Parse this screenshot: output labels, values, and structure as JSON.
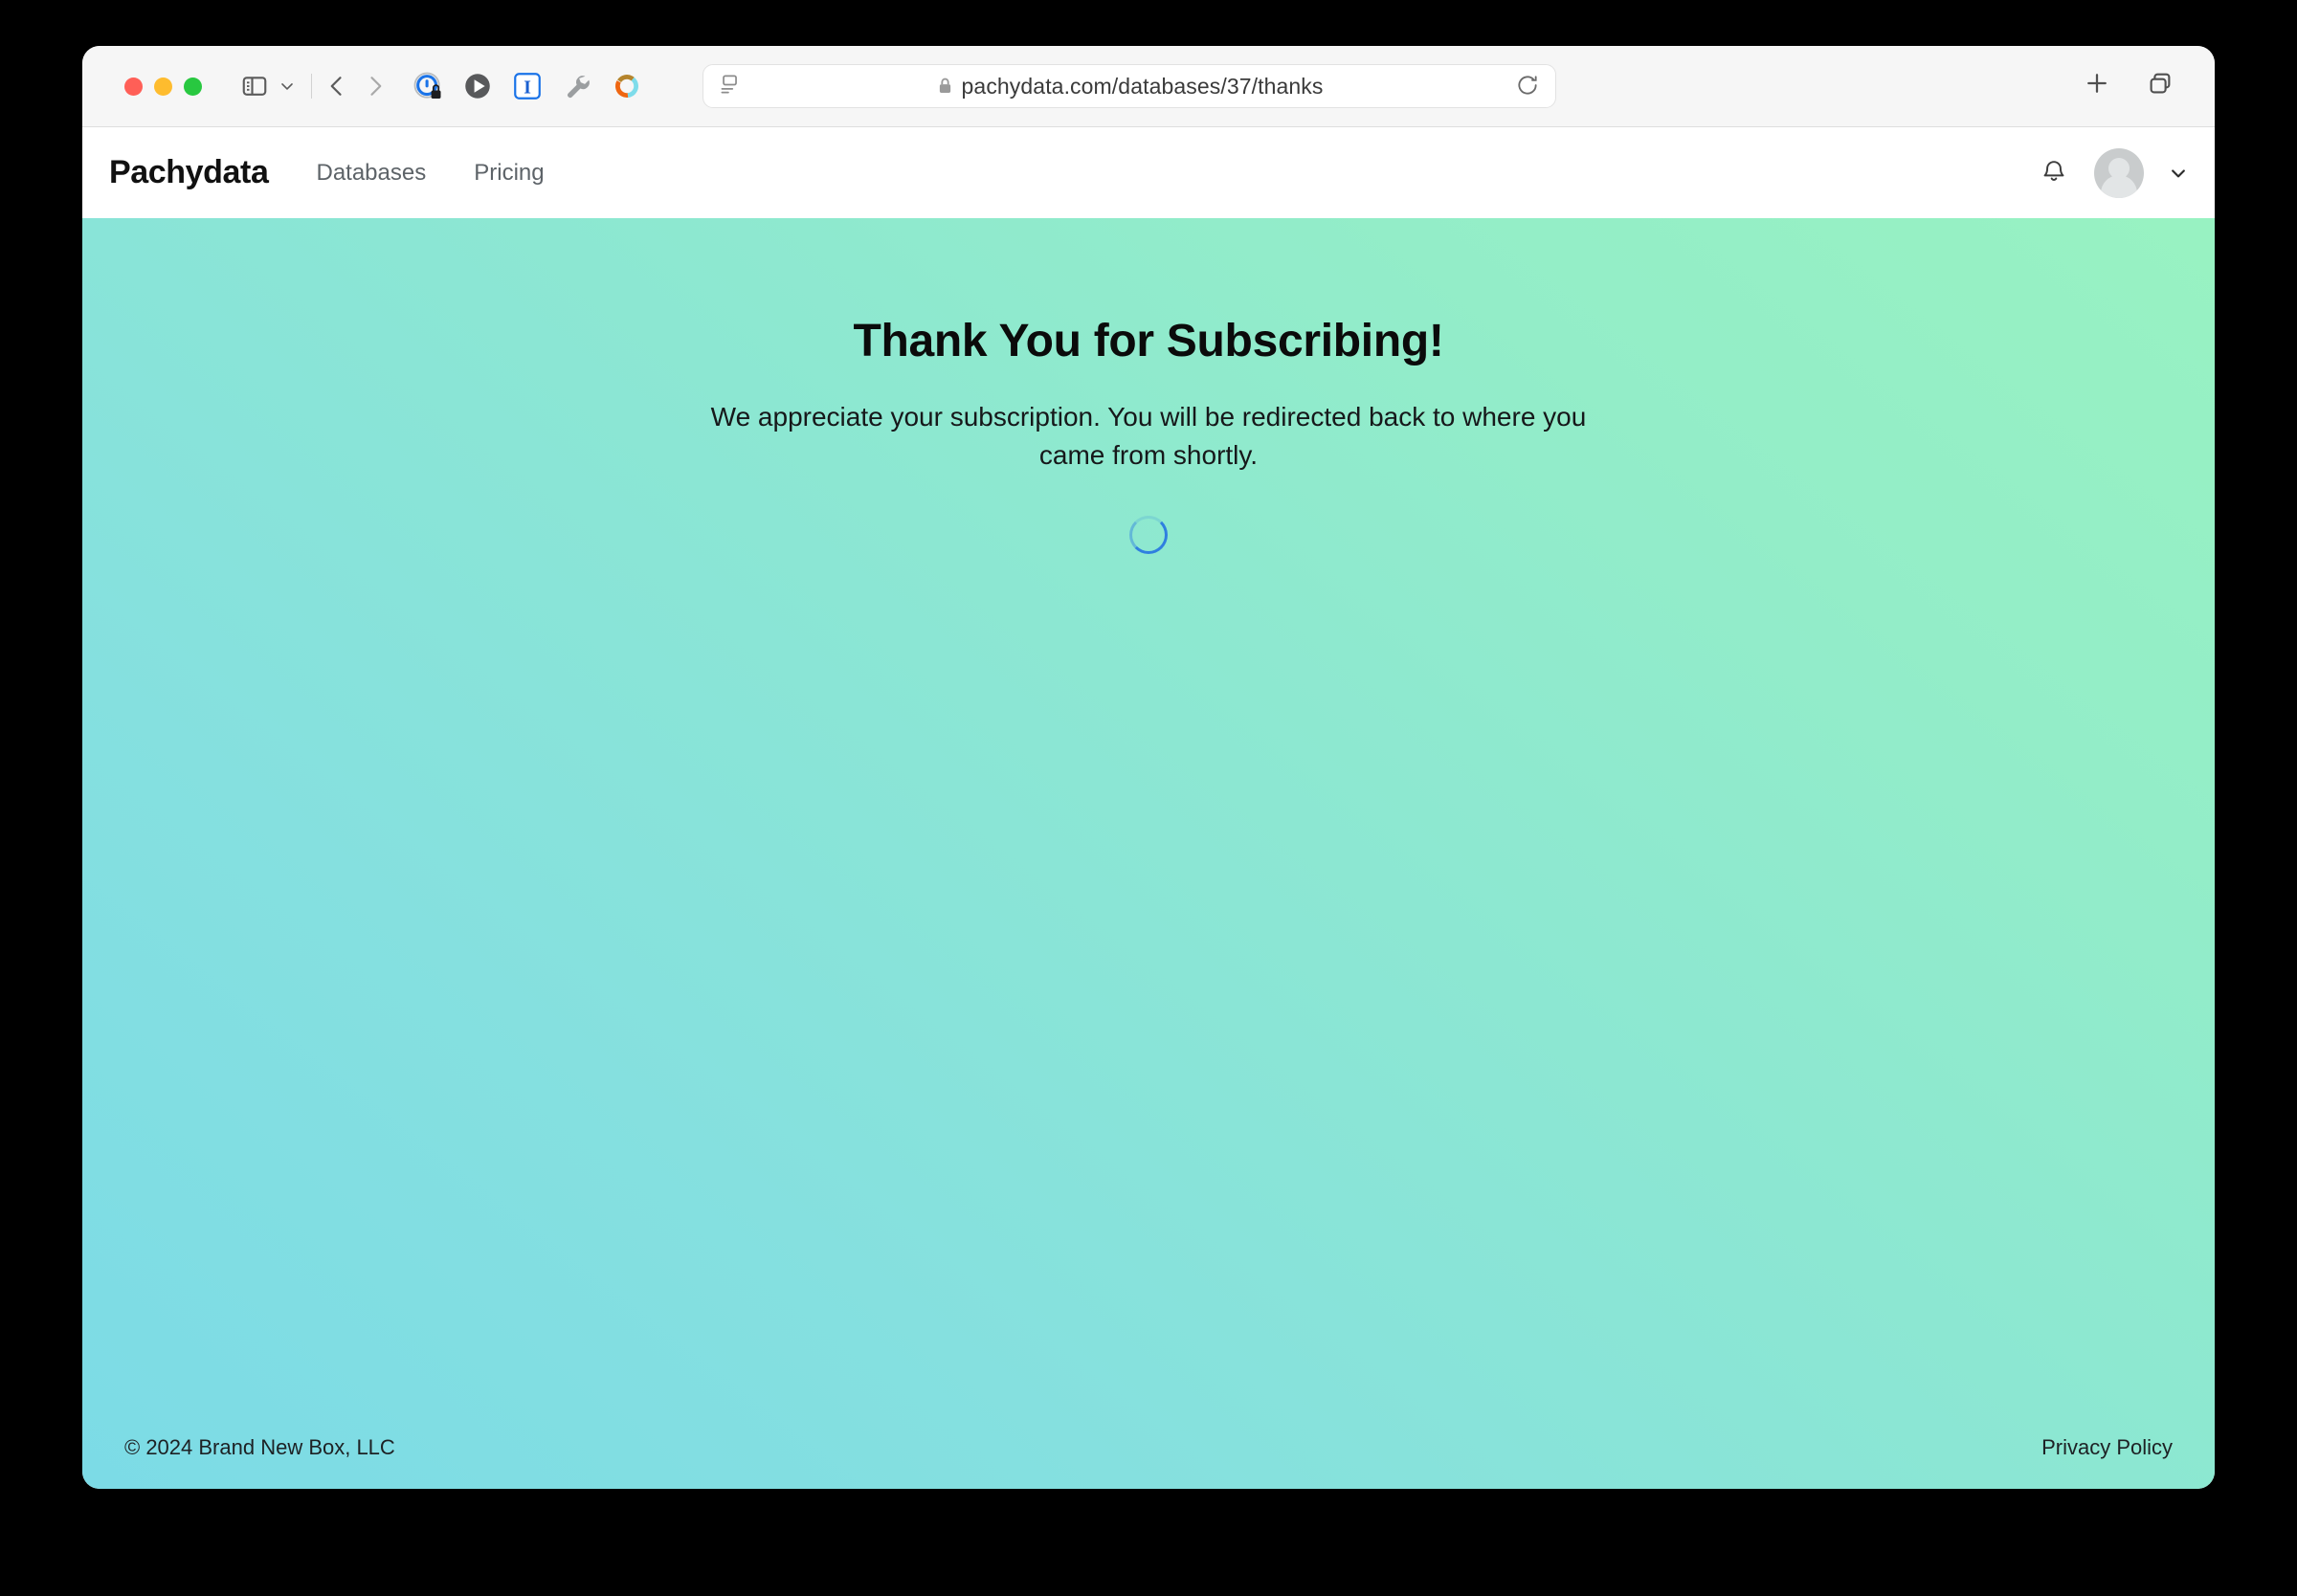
{
  "browser": {
    "window_controls": [
      "close",
      "minimize",
      "maximize"
    ],
    "url": "pachydata.com/databases/37/thanks",
    "lock_icon": "lock-icon",
    "reader_icon": "reader-view-icon",
    "reload_icon": "reload-icon",
    "sidebar_icon": "sidebar-toggle-icon",
    "back_icon": "back-arrow-icon",
    "forward_icon": "forward-arrow-icon",
    "new_tab_icon": "plus-icon",
    "tab_overview_icon": "tab-overview-icon",
    "extensions": [
      {
        "name": "privacy-shield-extension-icon"
      },
      {
        "name": "play-button-extension-icon"
      },
      {
        "name": "italic-i-extension-icon"
      },
      {
        "name": "wrench-extension-icon"
      },
      {
        "name": "donut-ring-extension-icon"
      }
    ]
  },
  "header": {
    "brand": "Pachydata",
    "nav": [
      {
        "label": "Databases"
      },
      {
        "label": "Pricing"
      }
    ],
    "bell_icon": "notification-bell-icon",
    "avatar_icon": "user-avatar",
    "chevron_icon": "chevron-down-icon"
  },
  "main": {
    "title": "Thank You for Subscribing!",
    "subtitle": "We appreciate your subscription. You will be redirected back to where you came from shortly.",
    "spinner": "loading-spinner",
    "spinner_color": "#2f7fe0"
  },
  "footer": {
    "copyright": "© 2024 Brand New Box, LLC",
    "privacy_label": "Privacy Policy"
  },
  "theme": {
    "gradient_start": "#7cdbe6",
    "gradient_end": "#98f2c2",
    "chrome_bg": "#f6f6f6",
    "header_bg": "#ffffff"
  }
}
